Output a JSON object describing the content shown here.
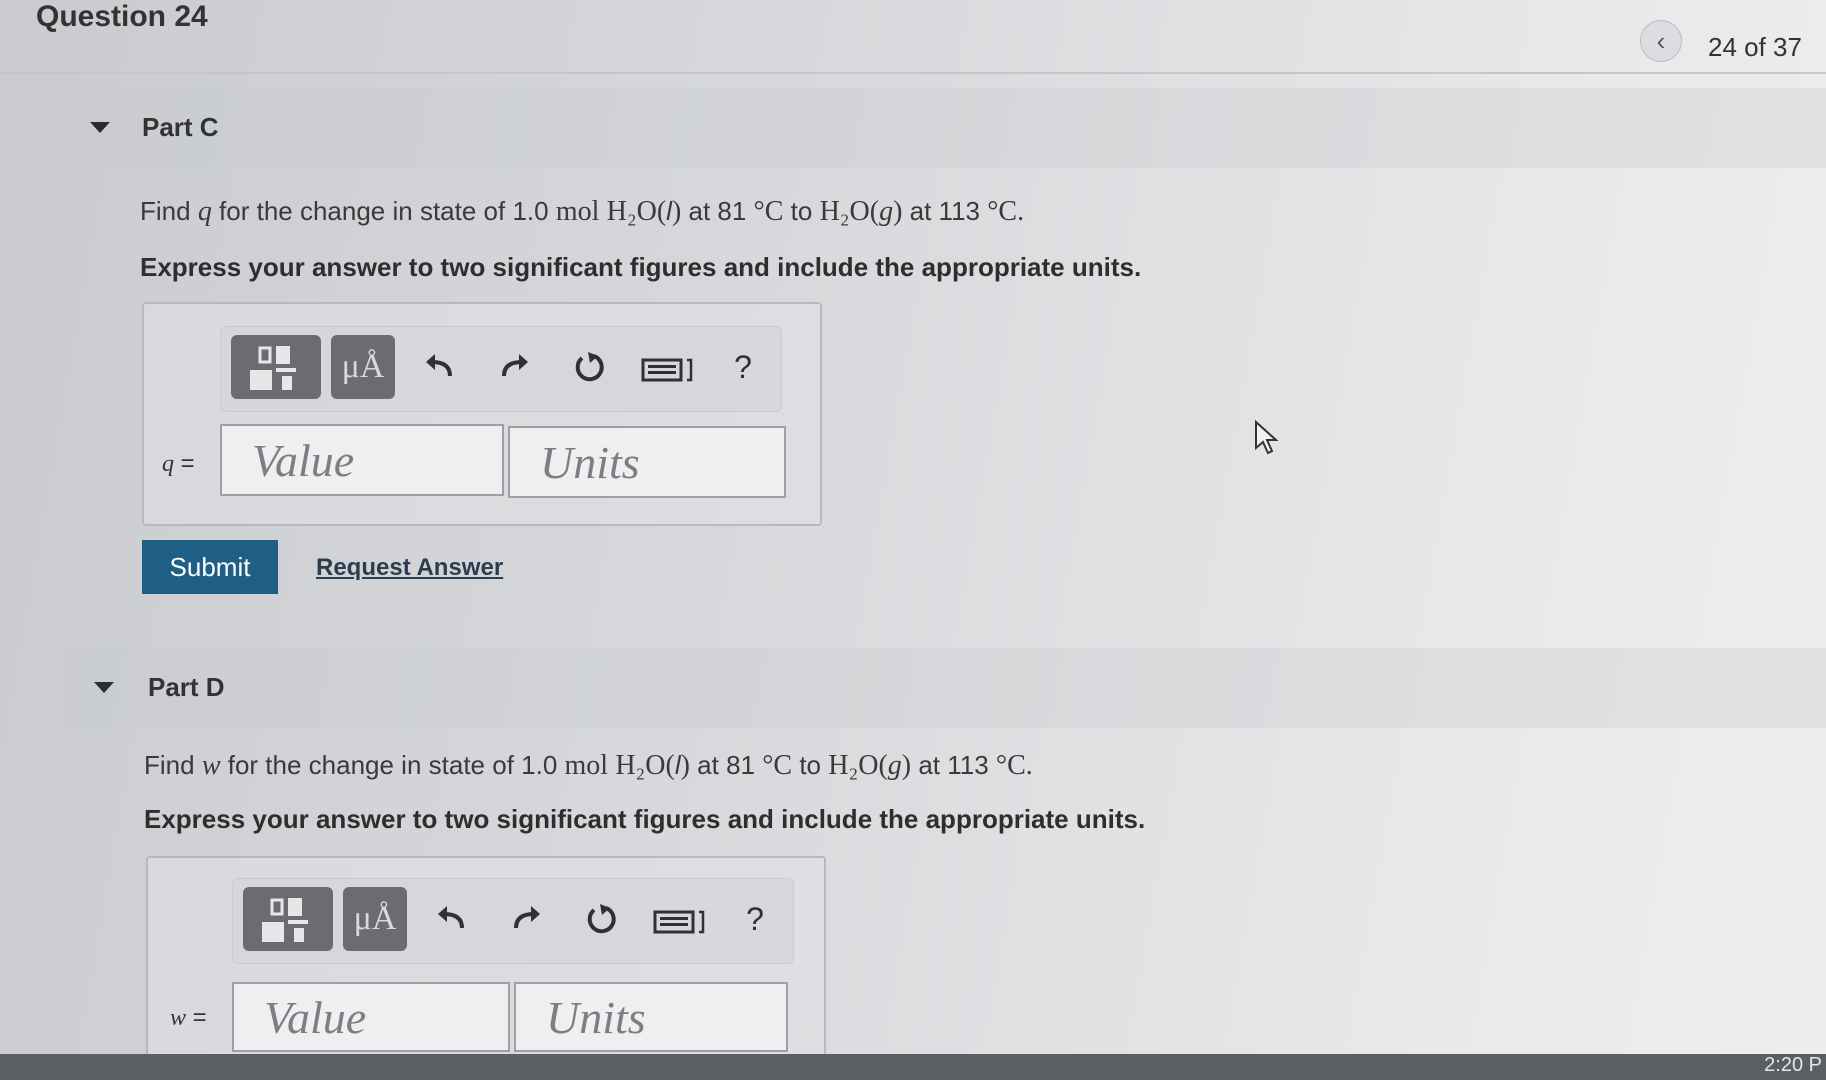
{
  "header": {
    "title": "Question 24",
    "pager": "24 of 37",
    "prev_icon": "chevron-left-icon"
  },
  "parts": [
    {
      "title": "Part C",
      "question_pre": "Find ",
      "question_var": "q",
      "question_mid1": " for the change in state of 1.0 ",
      "mol": "mol",
      "species1": "H₂O(",
      "phase1": "l",
      "species1_close": ")",
      "at1": " at 81 ",
      "temp_unit1": "°C",
      "to": " to ",
      "species2": "H₂O(",
      "phase2": "g",
      "species2_close": ")",
      "at2": " at 113 ",
      "temp_unit2": "°C.",
      "instructions": "Express your answer to two significant figures and include the appropriate units.",
      "var_label": "q",
      "value_placeholder": "Value",
      "units_placeholder": "Units",
      "submit_label": "Submit",
      "request_label": "Request Answer"
    },
    {
      "title": "Part D",
      "question_pre": "Find ",
      "question_var": "w",
      "question_mid1": " for the change in state of 1.0 ",
      "mol": "mol",
      "species1": "H₂O(",
      "phase1": "l",
      "species1_close": ")",
      "at1": " at 81 ",
      "temp_unit1": "°C",
      "to": " to ",
      "species2": "H₂O(",
      "phase2": "g",
      "species2_close": ")",
      "at2": " at 113 ",
      "temp_unit2": "°C.",
      "instructions": "Express your answer to two significant figures and include the appropriate units.",
      "var_label": "w",
      "value_placeholder": "Value",
      "units_placeholder": "Units"
    }
  ],
  "toolbar": {
    "templates_icon": "templates-icon",
    "units_button": "μÅ",
    "undo_icon": "undo-icon",
    "redo_icon": "redo-icon",
    "reset_icon": "reset-icon",
    "keyboard_icon": "keyboard-icon",
    "help": "?"
  },
  "taskbar": {
    "clock": "2:20 P"
  }
}
